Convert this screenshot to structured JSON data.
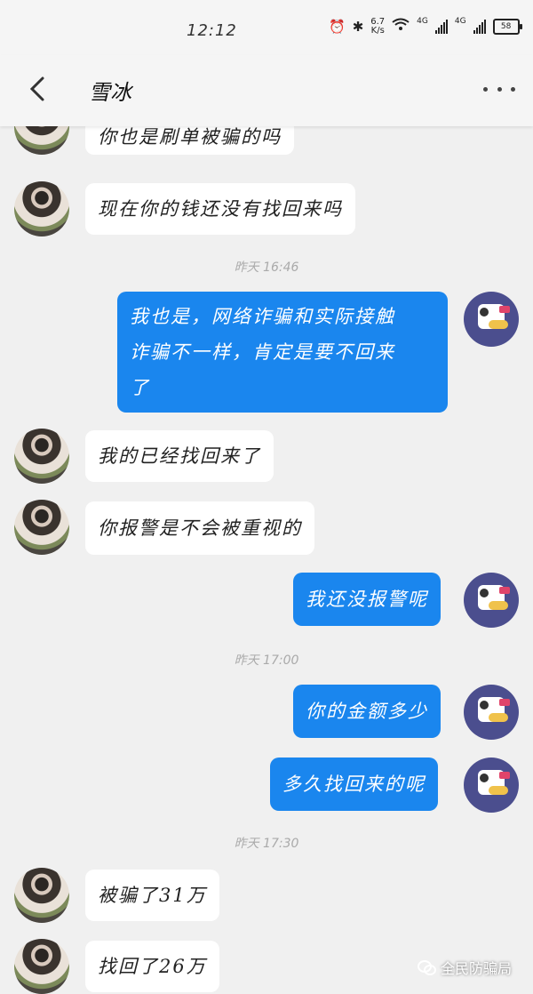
{
  "status_bar": {
    "time": "12:12",
    "net_speed_value": "6.7",
    "net_speed_unit": "K/s",
    "net_tag_1": "4G",
    "net_tag_2": "4G",
    "battery": "58",
    "icons": [
      "alarm-icon",
      "bluetooth-icon",
      "wifi-icon",
      "signal-icon",
      "signal-icon",
      "battery-icon"
    ]
  },
  "header": {
    "title": "雪冰",
    "back_icon": "chevron-left-icon",
    "more_icon": "more-horizontal-icon"
  },
  "messages": [
    {
      "side": "in",
      "text": "你也是刷单被骗的吗"
    },
    {
      "side": "in",
      "text": "现在你的钱还没有找回来吗"
    },
    {
      "timestamp": "昨天 16:46"
    },
    {
      "side": "out",
      "lines": [
        "我也是，网络诈骗和实际接触",
        "诈骗不一样，肯定是要不回来",
        "了"
      ]
    },
    {
      "side": "in",
      "text": "我的已经找回来了"
    },
    {
      "side": "in",
      "text": "你报警是不会被重视的"
    },
    {
      "side": "out",
      "text": "我还没报警呢"
    },
    {
      "timestamp": "昨天 17:00"
    },
    {
      "side": "out",
      "text": "你的金额多少"
    },
    {
      "side": "out",
      "text": "多久找回来的呢"
    },
    {
      "timestamp": "昨天 17:30"
    },
    {
      "side": "in",
      "text": "被骗了31万"
    },
    {
      "side": "in",
      "text": "找回了26万"
    }
  ],
  "watermark": "全民防骗局",
  "colors": {
    "outgoing_bubble": "#1a86ee",
    "incoming_bubble": "#ffffff",
    "background": "#f0f0f0"
  }
}
